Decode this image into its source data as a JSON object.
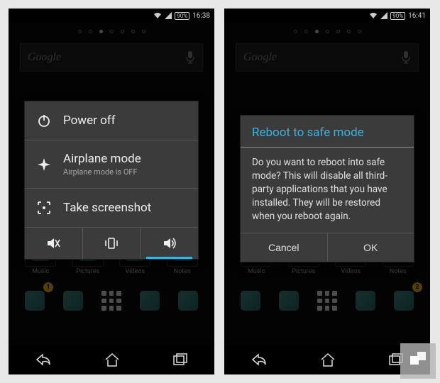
{
  "left": {
    "status": {
      "battery": "90%",
      "time": "16:38"
    },
    "search_placeholder": "Google",
    "power_menu": {
      "items": [
        {
          "title": "Power off",
          "sub": ""
        },
        {
          "title": "Airplane mode",
          "sub": "Airplane mode is OFF"
        },
        {
          "title": "Take screenshot",
          "sub": ""
        }
      ]
    },
    "apps": [
      {
        "label": "Music"
      },
      {
        "label": "Pictures"
      },
      {
        "label": "Videos"
      },
      {
        "label": "Notes"
      }
    ],
    "badge": "1"
  },
  "right": {
    "status": {
      "battery": "90%",
      "time": "16:41"
    },
    "search_placeholder": "Google",
    "dialog": {
      "title": "Reboot to safe mode",
      "body": "Do you want to reboot into safe mode? This will disable all third-party applications that you have installed. They will be restored when you reboot again.",
      "cancel": "Cancel",
      "ok": "OK"
    },
    "apps": [
      {
        "label": "Music"
      },
      {
        "label": "Pictures"
      },
      {
        "label": "Videos"
      },
      {
        "label": "Notes"
      }
    ],
    "badge": "2"
  }
}
